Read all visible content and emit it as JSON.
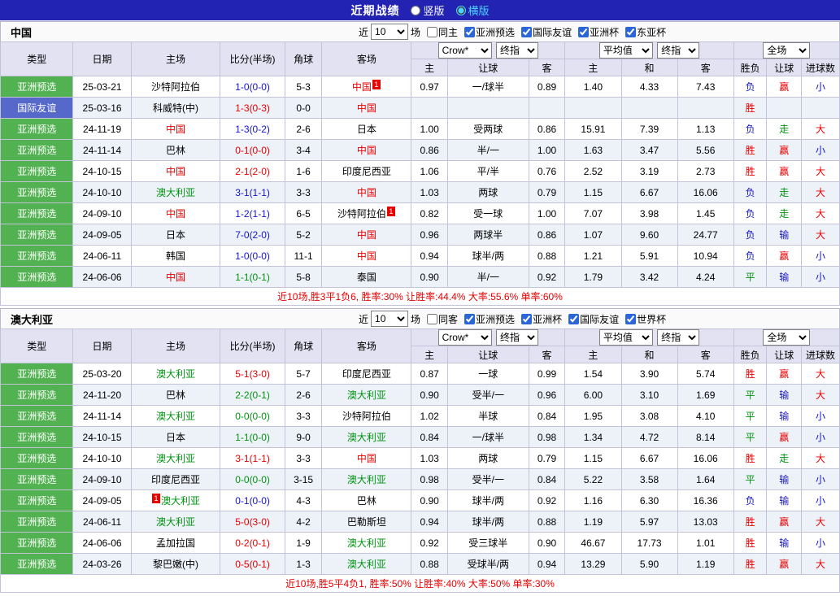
{
  "colors": {
    "title_bar_bg": "#2323b3",
    "type_asian_qualifier": "#52b151",
    "type_friendly": "#5668c9",
    "header_bg": "#e2e2f2",
    "row_alt_bg": "#edf1f8",
    "win_red": "#e60000",
    "draw_green": "#009310",
    "loss_blue": "#1414cc",
    "home_team_highlight": "#e60000",
    "away_team_highlight": "#009310",
    "active_radio_label": "#4dd2ff"
  },
  "title_bar": {
    "title": "近期战绩",
    "options": [
      {
        "label": "竖版",
        "checked": false
      },
      {
        "label": "横版",
        "checked": true
      }
    ]
  },
  "sections": [
    {
      "team": "中国",
      "filter": {
        "near": "近",
        "count": "10",
        "games": "场",
        "same": {
          "label": "同主",
          "checked": false
        },
        "leagues": [
          {
            "label": "亚洲预选",
            "checked": true
          },
          {
            "label": "国际友谊",
            "checked": true
          },
          {
            "label": "亚洲杯",
            "checked": true
          },
          {
            "label": "东亚杯",
            "checked": true
          }
        ]
      },
      "header": {
        "type": "类型",
        "date": "日期",
        "home": "主场",
        "score": "比分(半场)",
        "corner": "角球",
        "away": "客场",
        "bookmaker_select": "Crow*",
        "odds_type_select": "终指",
        "avg_select": "平均值",
        "avg_type_select": "终指",
        "scope_select": "全场",
        "sub": [
          "主",
          "让球",
          "客",
          "主",
          "和",
          "客",
          "胜负",
          "让球",
          "进球数"
        ]
      },
      "rows": [
        {
          "type": "亚洲预选",
          "type_color": "green",
          "date": "25-03-21",
          "home": "沙特阿拉伯",
          "home_color": "",
          "home_card": "",
          "score": "1-0(0-0)",
          "score_color": "blue",
          "corner": "5-3",
          "away": "中国",
          "away_color": "red",
          "away_card": "1",
          "odds": [
            "0.97",
            "一/球半",
            "0.89"
          ],
          "avg": [
            "1.40",
            "4.33",
            "7.43"
          ],
          "results": [
            [
              "负",
              "blue"
            ],
            [
              "赢",
              "red"
            ],
            [
              "小",
              "blue"
            ]
          ]
        },
        {
          "type": "国际友谊",
          "type_color": "blue",
          "date": "25-03-16",
          "home": "科威特(中)",
          "home_color": "",
          "home_card": "",
          "score": "1-3(0-3)",
          "score_color": "red",
          "corner": "0-0",
          "away": "中国",
          "away_color": "red",
          "away_card": "",
          "odds": [
            "",
            "",
            ""
          ],
          "avg": [
            "",
            "",
            ""
          ],
          "results": [
            [
              "胜",
              "red"
            ],
            [
              "",
              ""
            ],
            [
              "",
              ""
            ]
          ]
        },
        {
          "type": "亚洲预选",
          "type_color": "green",
          "date": "24-11-19",
          "home": "中国",
          "home_color": "red",
          "home_card": "",
          "score": "1-3(0-2)",
          "score_color": "blue",
          "corner": "2-6",
          "away": "日本",
          "away_color": "",
          "away_card": "",
          "odds": [
            "1.00",
            "受两球",
            "0.86"
          ],
          "avg": [
            "15.91",
            "7.39",
            "1.13"
          ],
          "results": [
            [
              "负",
              "blue"
            ],
            [
              "走",
              "green"
            ],
            [
              "大",
              "red"
            ]
          ]
        },
        {
          "type": "亚洲预选",
          "type_color": "green",
          "date": "24-11-14",
          "home": "巴林",
          "home_color": "",
          "home_card": "",
          "score": "0-1(0-0)",
          "score_color": "red",
          "corner": "3-4",
          "away": "中国",
          "away_color": "red",
          "away_card": "",
          "odds": [
            "0.86",
            "半/一",
            "1.00"
          ],
          "avg": [
            "1.63",
            "3.47",
            "5.56"
          ],
          "results": [
            [
              "胜",
              "red"
            ],
            [
              "赢",
              "red"
            ],
            [
              "小",
              "blue"
            ]
          ]
        },
        {
          "type": "亚洲预选",
          "type_color": "green",
          "date": "24-10-15",
          "home": "中国",
          "home_color": "red",
          "home_card": "",
          "score": "2-1(2-0)",
          "score_color": "red",
          "corner": "1-6",
          "away": "印度尼西亚",
          "away_color": "",
          "away_card": "",
          "odds": [
            "1.06",
            "平/半",
            "0.76"
          ],
          "avg": [
            "2.52",
            "3.19",
            "2.73"
          ],
          "results": [
            [
              "胜",
              "red"
            ],
            [
              "赢",
              "red"
            ],
            [
              "大",
              "red"
            ]
          ]
        },
        {
          "type": "亚洲预选",
          "type_color": "green",
          "date": "24-10-10",
          "home": "澳大利亚",
          "home_color": "green",
          "home_card": "",
          "score": "3-1(1-1)",
          "score_color": "blue",
          "corner": "3-3",
          "away": "中国",
          "away_color": "red",
          "away_card": "",
          "odds": [
            "1.03",
            "两球",
            "0.79"
          ],
          "avg": [
            "1.15",
            "6.67",
            "16.06"
          ],
          "results": [
            [
              "负",
              "blue"
            ],
            [
              "走",
              "green"
            ],
            [
              "大",
              "red"
            ]
          ]
        },
        {
          "type": "亚洲预选",
          "type_color": "green",
          "date": "24-09-10",
          "home": "中国",
          "home_color": "red",
          "home_card": "",
          "score": "1-2(1-1)",
          "score_color": "blue",
          "corner": "6-5",
          "away": "沙特阿拉伯",
          "away_color": "",
          "away_card": "1",
          "odds": [
            "0.82",
            "受一球",
            "1.00"
          ],
          "avg": [
            "7.07",
            "3.98",
            "1.45"
          ],
          "results": [
            [
              "负",
              "blue"
            ],
            [
              "走",
              "green"
            ],
            [
              "大",
              "red"
            ]
          ]
        },
        {
          "type": "亚洲预选",
          "type_color": "green",
          "date": "24-09-05",
          "home": "日本",
          "home_color": "",
          "home_card": "",
          "score": "7-0(2-0)",
          "score_color": "blue",
          "corner": "5-2",
          "away": "中国",
          "away_color": "red",
          "away_card": "",
          "odds": [
            "0.96",
            "两球半",
            "0.86"
          ],
          "avg": [
            "1.07",
            "9.60",
            "24.77"
          ],
          "results": [
            [
              "负",
              "blue"
            ],
            [
              "输",
              "blue"
            ],
            [
              "大",
              "red"
            ]
          ]
        },
        {
          "type": "亚洲预选",
          "type_color": "green",
          "date": "24-06-11",
          "home": "韩国",
          "home_color": "",
          "home_card": "",
          "score": "1-0(0-0)",
          "score_color": "blue",
          "corner": "11-1",
          "away": "中国",
          "away_color": "red",
          "away_card": "",
          "odds": [
            "0.94",
            "球半/两",
            "0.88"
          ],
          "avg": [
            "1.21",
            "5.91",
            "10.94"
          ],
          "results": [
            [
              "负",
              "blue"
            ],
            [
              "赢",
              "red"
            ],
            [
              "小",
              "blue"
            ]
          ]
        },
        {
          "type": "亚洲预选",
          "type_color": "green",
          "date": "24-06-06",
          "home": "中国",
          "home_color": "red",
          "home_card": "",
          "score": "1-1(0-1)",
          "score_color": "green",
          "corner": "5-8",
          "away": "泰国",
          "away_color": "",
          "away_card": "",
          "odds": [
            "0.90",
            "半/一",
            "0.92"
          ],
          "avg": [
            "1.79",
            "3.42",
            "4.24"
          ],
          "results": [
            [
              "平",
              "green"
            ],
            [
              "输",
              "blue"
            ],
            [
              "小",
              "blue"
            ]
          ]
        }
      ],
      "footer": "近10场,胜3平1负6, 胜率:30% 让胜率:44.4% 大率:55.6% 单率:60%"
    },
    {
      "team": "澳大利亚",
      "filter": {
        "near": "近",
        "count": "10",
        "games": "场",
        "same": {
          "label": "同客",
          "checked": false
        },
        "leagues": [
          {
            "label": "亚洲预选",
            "checked": true
          },
          {
            "label": "亚洲杯",
            "checked": true
          },
          {
            "label": "国际友谊",
            "checked": true
          },
          {
            "label": "世界杯",
            "checked": true
          }
        ]
      },
      "header": {
        "type": "类型",
        "date": "日期",
        "home": "主场",
        "score": "比分(半场)",
        "corner": "角球",
        "away": "客场",
        "bookmaker_select": "Crow*",
        "odds_type_select": "终指",
        "avg_select": "平均值",
        "avg_type_select": "终指",
        "scope_select": "全场",
        "sub": [
          "主",
          "让球",
          "客",
          "主",
          "和",
          "客",
          "胜负",
          "让球",
          "进球数"
        ]
      },
      "rows": [
        {
          "type": "亚洲预选",
          "type_color": "green",
          "date": "25-03-20",
          "home": "澳大利亚",
          "home_color": "green",
          "home_card": "",
          "score": "5-1(3-0)",
          "score_color": "red",
          "corner": "5-7",
          "away": "印度尼西亚",
          "away_color": "",
          "away_card": "",
          "odds": [
            "0.87",
            "一球",
            "0.99"
          ],
          "avg": [
            "1.54",
            "3.90",
            "5.74"
          ],
          "results": [
            [
              "胜",
              "red"
            ],
            [
              "赢",
              "red"
            ],
            [
              "大",
              "red"
            ]
          ]
        },
        {
          "type": "亚洲预选",
          "type_color": "green",
          "date": "24-11-20",
          "home": "巴林",
          "home_color": "",
          "home_card": "",
          "score": "2-2(0-1)",
          "score_color": "green",
          "corner": "2-6",
          "away": "澳大利亚",
          "away_color": "green",
          "away_card": "",
          "odds": [
            "0.90",
            "受半/一",
            "0.96"
          ],
          "avg": [
            "6.00",
            "3.10",
            "1.69"
          ],
          "results": [
            [
              "平",
              "green"
            ],
            [
              "输",
              "blue"
            ],
            [
              "大",
              "red"
            ]
          ]
        },
        {
          "type": "亚洲预选",
          "type_color": "green",
          "date": "24-11-14",
          "home": "澳大利亚",
          "home_color": "green",
          "home_card": "",
          "score": "0-0(0-0)",
          "score_color": "green",
          "corner": "3-3",
          "away": "沙特阿拉伯",
          "away_color": "",
          "away_card": "",
          "odds": [
            "1.02",
            "半球",
            "0.84"
          ],
          "avg": [
            "1.95",
            "3.08",
            "4.10"
          ],
          "results": [
            [
              "平",
              "green"
            ],
            [
              "输",
              "blue"
            ],
            [
              "小",
              "blue"
            ]
          ]
        },
        {
          "type": "亚洲预选",
          "type_color": "green",
          "date": "24-10-15",
          "home": "日本",
          "home_color": "",
          "home_card": "",
          "score": "1-1(0-0)",
          "score_color": "green",
          "corner": "9-0",
          "away": "澳大利亚",
          "away_color": "green",
          "away_card": "",
          "odds": [
            "0.84",
            "一/球半",
            "0.98"
          ],
          "avg": [
            "1.34",
            "4.72",
            "8.14"
          ],
          "results": [
            [
              "平",
              "green"
            ],
            [
              "赢",
              "red"
            ],
            [
              "小",
              "blue"
            ]
          ]
        },
        {
          "type": "亚洲预选",
          "type_color": "green",
          "date": "24-10-10",
          "home": "澳大利亚",
          "home_color": "green",
          "home_card": "",
          "score": "3-1(1-1)",
          "score_color": "red",
          "corner": "3-3",
          "away": "中国",
          "away_color": "red",
          "away_card": "",
          "odds": [
            "1.03",
            "两球",
            "0.79"
          ],
          "avg": [
            "1.15",
            "6.67",
            "16.06"
          ],
          "results": [
            [
              "胜",
              "red"
            ],
            [
              "走",
              "green"
            ],
            [
              "大",
              "red"
            ]
          ]
        },
        {
          "type": "亚洲预选",
          "type_color": "green",
          "date": "24-09-10",
          "home": "印度尼西亚",
          "home_color": "",
          "home_card": "",
          "score": "0-0(0-0)",
          "score_color": "green",
          "corner": "3-15",
          "away": "澳大利亚",
          "away_color": "green",
          "away_card": "",
          "odds": [
            "0.98",
            "受半/一",
            "0.84"
          ],
          "avg": [
            "5.22",
            "3.58",
            "1.64"
          ],
          "results": [
            [
              "平",
              "green"
            ],
            [
              "输",
              "blue"
            ],
            [
              "小",
              "blue"
            ]
          ]
        },
        {
          "type": "亚洲预选",
          "type_color": "green",
          "date": "24-09-05",
          "home": "澳大利亚",
          "home_color": "green",
          "home_card": "1",
          "home_card_pos": "before",
          "score": "0-1(0-0)",
          "score_color": "blue",
          "corner": "4-3",
          "away": "巴林",
          "away_color": "",
          "away_card": "",
          "odds": [
            "0.90",
            "球半/两",
            "0.92"
          ],
          "avg": [
            "1.16",
            "6.30",
            "16.36"
          ],
          "results": [
            [
              "负",
              "blue"
            ],
            [
              "输",
              "blue"
            ],
            [
              "小",
              "blue"
            ]
          ]
        },
        {
          "type": "亚洲预选",
          "type_color": "green",
          "date": "24-06-11",
          "home": "澳大利亚",
          "home_color": "green",
          "home_card": "",
          "score": "5-0(3-0)",
          "score_color": "red",
          "corner": "4-2",
          "away": "巴勒斯坦",
          "away_color": "",
          "away_card": "",
          "odds": [
            "0.94",
            "球半/两",
            "0.88"
          ],
          "avg": [
            "1.19",
            "5.97",
            "13.03"
          ],
          "results": [
            [
              "胜",
              "red"
            ],
            [
              "赢",
              "red"
            ],
            [
              "大",
              "red"
            ]
          ]
        },
        {
          "type": "亚洲预选",
          "type_color": "green",
          "date": "24-06-06",
          "home": "孟加拉国",
          "home_color": "",
          "home_card": "",
          "score": "0-2(0-1)",
          "score_color": "red",
          "corner": "1-9",
          "away": "澳大利亚",
          "away_color": "green",
          "away_card": "",
          "odds": [
            "0.92",
            "受三球半",
            "0.90"
          ],
          "avg": [
            "46.67",
            "17.73",
            "1.01"
          ],
          "results": [
            [
              "胜",
              "red"
            ],
            [
              "输",
              "blue"
            ],
            [
              "小",
              "blue"
            ]
          ]
        },
        {
          "type": "亚洲预选",
          "type_color": "green",
          "date": "24-03-26",
          "home": "黎巴嫩(中)",
          "home_color": "",
          "home_card": "",
          "score": "0-5(0-1)",
          "score_color": "red",
          "corner": "1-3",
          "away": "澳大利亚",
          "away_color": "green",
          "away_card": "",
          "odds": [
            "0.88",
            "受球半/两",
            "0.94"
          ],
          "avg": [
            "13.29",
            "5.90",
            "1.19"
          ],
          "results": [
            [
              "胜",
              "red"
            ],
            [
              "赢",
              "red"
            ],
            [
              "大",
              "red"
            ]
          ]
        }
      ],
      "footer": "近10场,胜5平4负1, 胜率:50% 让胜率:40% 大率:50% 单率:30%"
    }
  ]
}
